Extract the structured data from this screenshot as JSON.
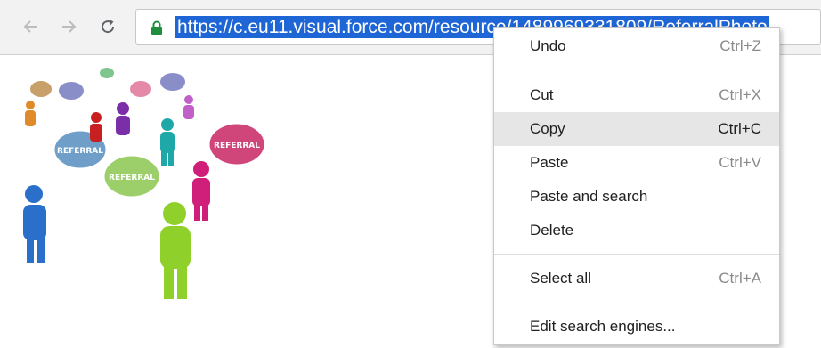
{
  "browser": {
    "url": "https://c.eu11.visual.force.com/resource/1489969331809/ReferralPhoto"
  },
  "page": {
    "image_bubble_text": "REFERRAL"
  },
  "context_menu": {
    "items": [
      {
        "label": "Undo",
        "shortcut": "Ctrl+Z"
      },
      {
        "label": "Cut",
        "shortcut": "Ctrl+X"
      },
      {
        "label": "Copy",
        "shortcut": "Ctrl+C"
      },
      {
        "label": "Paste",
        "shortcut": "Ctrl+V"
      },
      {
        "label": "Paste and search",
        "shortcut": ""
      },
      {
        "label": "Delete",
        "shortcut": ""
      },
      {
        "label": "Select all",
        "shortcut": "Ctrl+A"
      },
      {
        "label": "Edit search engines...",
        "shortcut": ""
      }
    ]
  },
  "colors": {
    "selection": "#1e66d6",
    "highlight": "#e6e6e6",
    "lock": "#1e8e3e"
  },
  "icons": [
    "back-arrow-icon",
    "forward-arrow-icon",
    "reload-icon",
    "lock-icon"
  ]
}
